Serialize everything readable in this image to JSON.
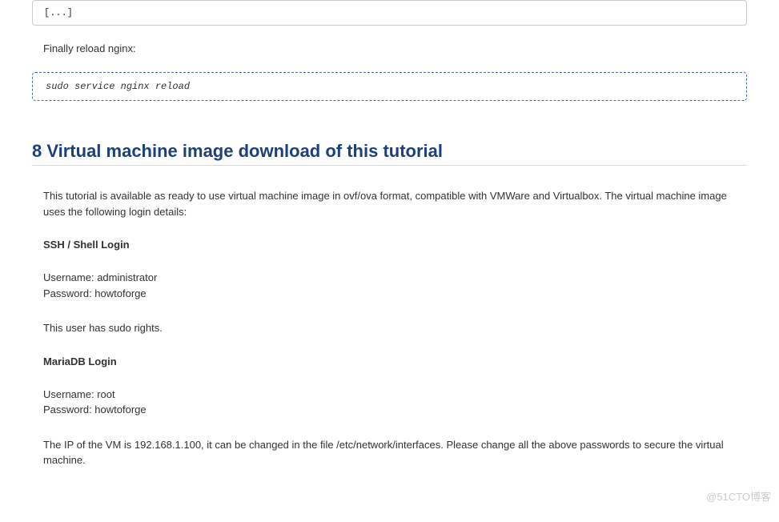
{
  "topCode": "[...]",
  "finallyReload": "Finally reload nginx:",
  "reloadCommand": "sudo service nginx reload",
  "sectionHeading": "8 Virtual machine image download of this tutorial",
  "intro": "This tutorial is available as ready to use virtual machine image in ovf/ova format, compatible with VMWare and Virtualbox. The virtual machine image uses the following login details:",
  "sshHeading": "SSH / Shell Login",
  "ssh": {
    "username": "Username: administrator",
    "password": "Password: howtoforge"
  },
  "sudoNote": "This user has sudo rights.",
  "mariadbHeading": "MariaDB Login",
  "mariadb": {
    "username": "Username: root",
    "password": "Password: howtoforge"
  },
  "ipNote": "The IP of the VM is 192.168.1.100, it can be changed in the file /etc/network/interfaces. Please change all the above passwords to secure the virtual machine.",
  "watermark": "@51CTO博客"
}
